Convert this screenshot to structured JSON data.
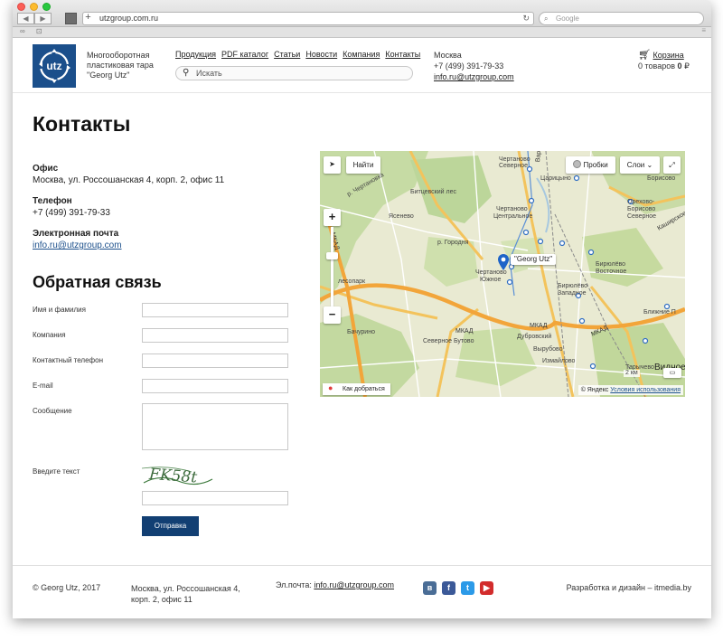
{
  "browser": {
    "url": "utzgroup.com.ru",
    "search_placeholder": "Google",
    "reload_icon": "reload-icon"
  },
  "header": {
    "logo_text": "utz",
    "tagline_line1": "Многооборотная",
    "tagline_line2": "пластиковая тара",
    "tagline_line3": "\"Georg Utz\"",
    "menu": [
      "Продукция",
      "PDF каталог",
      "Статьи",
      "Новости",
      "Компания",
      "Контакты"
    ],
    "search_placeholder": "Искать",
    "city": "Москва",
    "phone": "+7 (499) 391-79-33",
    "email": "info.ru@utzgroup.com",
    "cart_label": "Корзина",
    "cart_count": "0 товаров",
    "cart_total": "0",
    "currency": "₽"
  },
  "page": {
    "title": "Контакты",
    "office_label": "Офис",
    "office_value": "Москва, ул. Россошанская 4, корп. 2, офис 11",
    "phone_label": "Телефон",
    "phone_value": "+7 (499) 391-79-33",
    "email_label": "Электронная почта",
    "email_value": "info.ru@utzgroup.com"
  },
  "form": {
    "title": "Обратная связь",
    "fields": [
      "Имя и фамилия",
      "Компания",
      "Контактный телефон",
      "E-mail",
      "Сообщение"
    ],
    "captcha_label": "Введите текст",
    "captcha_text": "FK58t",
    "submit_label": "Отправка"
  },
  "map": {
    "find_label": "Найти",
    "traffic_label": "Пробки",
    "layers_label": "Слои",
    "marker_label": "\"Georg Utz\"",
    "route_label": "Как добраться",
    "scale_label": "2 км",
    "copyright": "© Яндекс",
    "terms": "Условия использования",
    "places": {
      "chertanovo_sev1": "Чертаново",
      "chertanovo_sev2": "Северное",
      "chertanovo_c1": "Чертаново",
      "chertanovo_c2": "Центральное",
      "chertanovo_yu1": "Чертаново",
      "chertanovo_yu2": "Южное",
      "tsaritsyno": "Царицыно",
      "orekhovo1": "Орехово-",
      "orekhovo2": "Борисово",
      "orekhovo3": "Северное",
      "borisovo": "Борисово",
      "biryulevo_v1": "Бирюлёво",
      "biryulevo_v2": "Восточное",
      "biryulevo_z1": "Бирюлёво",
      "biryulevo_z2": "Западное",
      "yasenevo": "Ясенево",
      "bitsevsky": "Битцевский лес",
      "gorodnya": "р. Городня",
      "lesopark": "лесопарк",
      "bachurino": "Бачурино",
      "severnoe_butovo": "Северное Бутово",
      "dubrovsky": "Дубровский",
      "vyrubovo": "Вырубово",
      "izmaylovo": "Измайлово",
      "tarychevo": "Тарычево",
      "vidnoe": "Видное",
      "blizhnie": "Ближние П",
      "varshavskoe": "Варшавское ш.",
      "kashirskoe": "Каширское",
      "mkad1": "МКАД",
      "mkad2": "МКАД",
      "mkad3": "МКАД",
      "mkad_left": "МКАД",
      "river": "р. Чертановка"
    }
  },
  "footer": {
    "copyright": "© Georg Utz, 2017",
    "address_line1": "Москва, ул. Россошанская 4,",
    "address_line2": "корп. 2, офис 11",
    "email_label": "Эл.почта:",
    "email": "info.ru@utzgroup.com",
    "developer": "Разработка и дизайн – itmedia.by",
    "social": [
      "vk-icon",
      "facebook-icon",
      "twitter-icon",
      "youtube-icon"
    ]
  }
}
